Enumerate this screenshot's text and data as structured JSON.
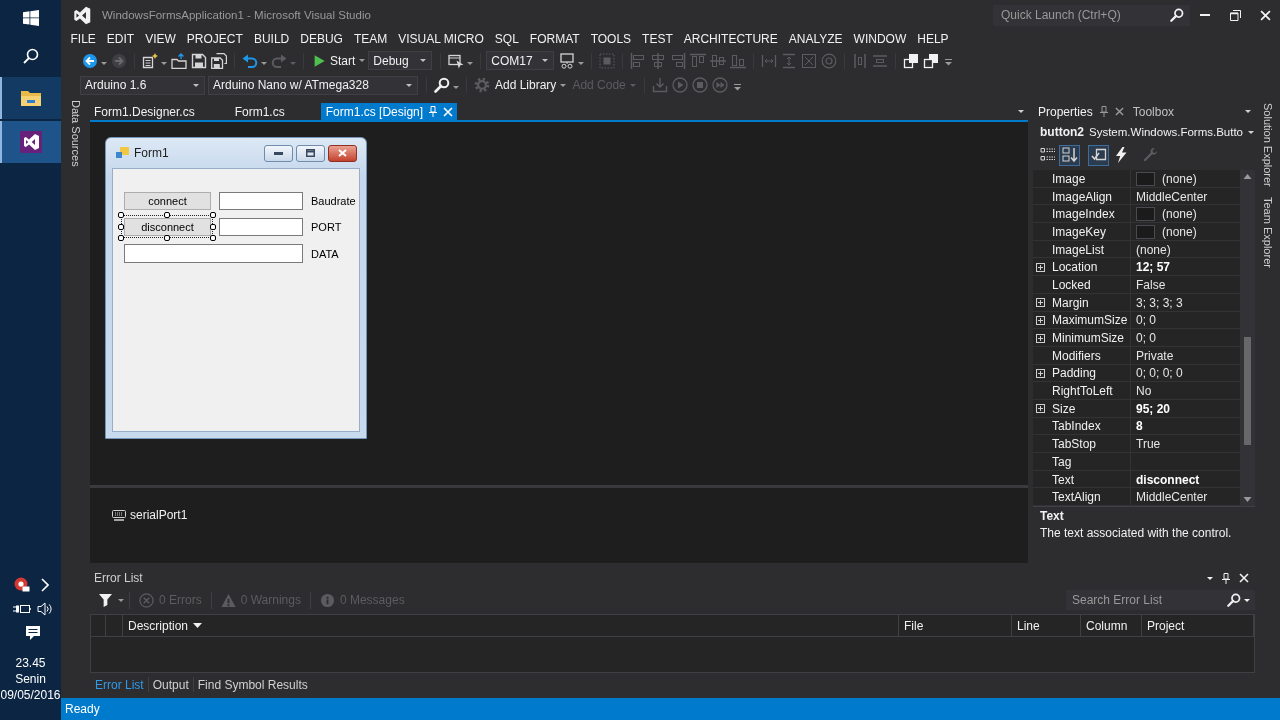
{
  "taskbar": {
    "apps": [
      {
        "kind": "files",
        "active": false
      },
      {
        "kind": "studio",
        "active": true
      }
    ],
    "clock": {
      "time": "23.45",
      "day": "Senin",
      "date": "09/05/2016"
    }
  },
  "window": {
    "title": "WindowsFormsApplication1 - Microsoft Visual Studio",
    "quick_launch": {
      "placeholder": "Quick Launch (Ctrl+Q)"
    }
  },
  "menu": [
    "FILE",
    "EDIT",
    "VIEW",
    "PROJECT",
    "BUILD",
    "DEBUG",
    "TEAM",
    "VISUAL MICRO",
    "SQL",
    "FORMAT",
    "TOOLS",
    "TEST",
    "ARCHITECTURE",
    "ANALYZE",
    "WINDOW",
    "HELP"
  ],
  "toolbar": [
    {
      "kind": "back",
      "disabled": false
    },
    {
      "kind": "forward",
      "disabled": true
    },
    {
      "kind": "separator"
    },
    {
      "kind": "new-project",
      "disabled": false
    },
    {
      "kind": "open",
      "disabled": false
    },
    {
      "kind": "save",
      "disabled": false
    },
    {
      "kind": "save-all",
      "disabled": false
    },
    {
      "kind": "separator"
    },
    {
      "kind": "undo",
      "disabled": false
    },
    {
      "kind": "redo",
      "disabled": true
    },
    {
      "kind": "separator"
    },
    {
      "kind": "start",
      "label": "Start",
      "disabled": false
    },
    {
      "kind": "combo",
      "value": "Debug"
    },
    {
      "kind": "separator"
    },
    {
      "kind": "window-cursor",
      "disabled": false
    },
    {
      "kind": "separator"
    },
    {
      "kind": "combo",
      "value": "COM17"
    },
    {
      "kind": "monitor",
      "disabled": false
    },
    {
      "kind": "separator"
    },
    {
      "kind": "align-grid",
      "disabled": true
    },
    {
      "kind": "separator"
    },
    {
      "kind": "align-left",
      "disabled": true
    },
    {
      "kind": "align-center",
      "disabled": true
    },
    {
      "kind": "align-right",
      "disabled": true
    },
    {
      "kind": "align-top",
      "disabled": true
    },
    {
      "kind": "align-middle",
      "disabled": true
    },
    {
      "kind": "align-bottom",
      "disabled": true
    },
    {
      "kind": "separator"
    },
    {
      "kind": "same-width",
      "disabled": true
    },
    {
      "kind": "same-height",
      "disabled": true
    },
    {
      "kind": "same-size",
      "disabled": true
    },
    {
      "kind": "size-grid",
      "disabled": true
    },
    {
      "kind": "separator"
    },
    {
      "kind": "space-h",
      "disabled": true
    },
    {
      "kind": "space-v",
      "disabled": true
    },
    {
      "kind": "separator"
    },
    {
      "kind": "bring-front",
      "disabled": false
    },
    {
      "kind": "send-back",
      "disabled": false
    },
    {
      "kind": "overflow"
    }
  ],
  "arduino_toolbar": [
    {
      "kind": "combo",
      "value": "Arduino 1.6"
    },
    {
      "kind": "combo",
      "value": "Arduino Nano w/ ATmega328"
    },
    {
      "kind": "separator"
    },
    {
      "kind": "search",
      "disabled": false
    },
    {
      "kind": "separator"
    },
    {
      "kind": "gear",
      "disabled": true
    },
    {
      "kind": "text-menu",
      "label": "Add Library",
      "disabled": false
    },
    {
      "kind": "text-menu",
      "label": "Add Code",
      "disabled": true
    },
    {
      "kind": "separator"
    },
    {
      "kind": "download",
      "disabled": true
    },
    {
      "kind": "play-circle",
      "disabled": true
    },
    {
      "kind": "stop-circle",
      "disabled": true
    },
    {
      "kind": "fast-forward-circle",
      "disabled": true
    },
    {
      "kind": "overflow"
    }
  ],
  "left_tool_tabs": [
    "Data Sources"
  ],
  "document_tabs": [
    {
      "label": "Form1.Designer.cs",
      "selected": false
    },
    {
      "label": "Form1.cs",
      "selected": false
    },
    {
      "label": "Form1.cs [Design]",
      "selected": true
    }
  ],
  "form": {
    "title": "Form1",
    "controls": [
      {
        "kind": "button",
        "text": "connect",
        "selected": false
      },
      {
        "kind": "textbox",
        "selected": false
      },
      {
        "kind": "label",
        "text": "Baudrate",
        "selected": false
      },
      {
        "kind": "button",
        "text": "disconnect",
        "selected": true
      },
      {
        "kind": "textbox",
        "selected": false
      },
      {
        "kind": "label",
        "text": "PORT",
        "selected": false
      },
      {
        "kind": "wide-textbox",
        "selected": false
      },
      {
        "kind": "label",
        "text": "DATA",
        "selected": false
      }
    ]
  },
  "component_tray": [
    {
      "kind": "serial-port",
      "name": "serialPort1"
    }
  ],
  "properties": {
    "tabs": [
      {
        "label": "Properties",
        "selected": true
      },
      {
        "label": "Toolbox",
        "selected": false
      }
    ],
    "object": {
      "name": "button2",
      "type": "System.Windows.Forms.Butto"
    },
    "view_buttons": [
      {
        "kind": "categorized",
        "on": false,
        "disabled": false
      },
      {
        "kind": "alphabetical",
        "on": true,
        "disabled": false
      },
      {
        "kind": "separator"
      },
      {
        "kind": "properties",
        "on": true,
        "disabled": false
      },
      {
        "kind": "events",
        "on": false,
        "disabled": false
      },
      {
        "kind": "separator"
      },
      {
        "kind": "property-pages",
        "on": false,
        "disabled": true
      }
    ],
    "rows": [
      {
        "name": "Image",
        "value": "(none)",
        "expandable": false,
        "swatch": true,
        "modified": false
      },
      {
        "name": "ImageAlign",
        "value": "MiddleCenter",
        "expandable": false,
        "swatch": false,
        "modified": false
      },
      {
        "name": "ImageIndex",
        "value": "(none)",
        "expandable": false,
        "swatch": true,
        "modified": false
      },
      {
        "name": "ImageKey",
        "value": "(none)",
        "expandable": false,
        "swatch": true,
        "modified": false
      },
      {
        "name": "ImageList",
        "value": "(none)",
        "expandable": false,
        "swatch": false,
        "modified": false
      },
      {
        "name": "Location",
        "value": "12; 57",
        "expandable": true,
        "swatch": false,
        "modified": true
      },
      {
        "name": "Locked",
        "value": "False",
        "expandable": false,
        "swatch": false,
        "modified": false
      },
      {
        "name": "Margin",
        "value": "3; 3; 3; 3",
        "expandable": true,
        "swatch": false,
        "modified": false
      },
      {
        "name": "MaximumSize",
        "value": "0; 0",
        "expandable": true,
        "swatch": false,
        "modified": false
      },
      {
        "name": "MinimumSize",
        "value": "0; 0",
        "expandable": true,
        "swatch": false,
        "modified": false
      },
      {
        "name": "Modifiers",
        "value": "Private",
        "expandable": false,
        "swatch": false,
        "modified": false
      },
      {
        "name": "Padding",
        "value": "0; 0; 0; 0",
        "expandable": true,
        "swatch": false,
        "modified": false
      },
      {
        "name": "RightToLeft",
        "value": "No",
        "expandable": false,
        "swatch": false,
        "modified": false
      },
      {
        "name": "Size",
        "value": "95; 20",
        "expandable": true,
        "swatch": false,
        "modified": true
      },
      {
        "name": "TabIndex",
        "value": "8",
        "expandable": false,
        "swatch": false,
        "modified": true
      },
      {
        "name": "TabStop",
        "value": "True",
        "expandable": false,
        "swatch": false,
        "modified": false
      },
      {
        "name": "Tag",
        "expandable": false,
        "swatch": false
      },
      {
        "name": "Text",
        "value": "disconnect",
        "expandable": false,
        "swatch": false,
        "modified": true
      },
      {
        "name": "TextAlign",
        "value": "MiddleCenter",
        "expandable": false,
        "swatch": false,
        "modified": false
      }
    ],
    "description": {
      "title": "Text",
      "text": "The text associated with the control."
    }
  },
  "right_tool_tabs": [
    "Solution Explorer",
    "Team Explorer"
  ],
  "error_list": {
    "title": "Error List",
    "counters": [
      {
        "kind": "error",
        "label": "0 Errors",
        "disabled": true
      },
      {
        "kind": "warning",
        "label": "0 Warnings",
        "disabled": true
      },
      {
        "kind": "message",
        "label": "0 Messages",
        "disabled": true
      }
    ],
    "search": {
      "placeholder": "Search Error List"
    },
    "columns": [
      {
        "label": "Description",
        "sorted": true
      },
      {
        "label": "File",
        "sorted": false
      },
      {
        "label": "Line",
        "sorted": false
      },
      {
        "label": "Column",
        "sorted": false
      },
      {
        "label": "Project",
        "sorted": false
      }
    ],
    "tabs": [
      {
        "label": "Error List",
        "selected": true
      },
      {
        "label": "Output",
        "selected": false
      },
      {
        "label": "Find Symbol Results",
        "selected": false
      }
    ]
  },
  "status_bar": {
    "text": "Ready"
  }
}
